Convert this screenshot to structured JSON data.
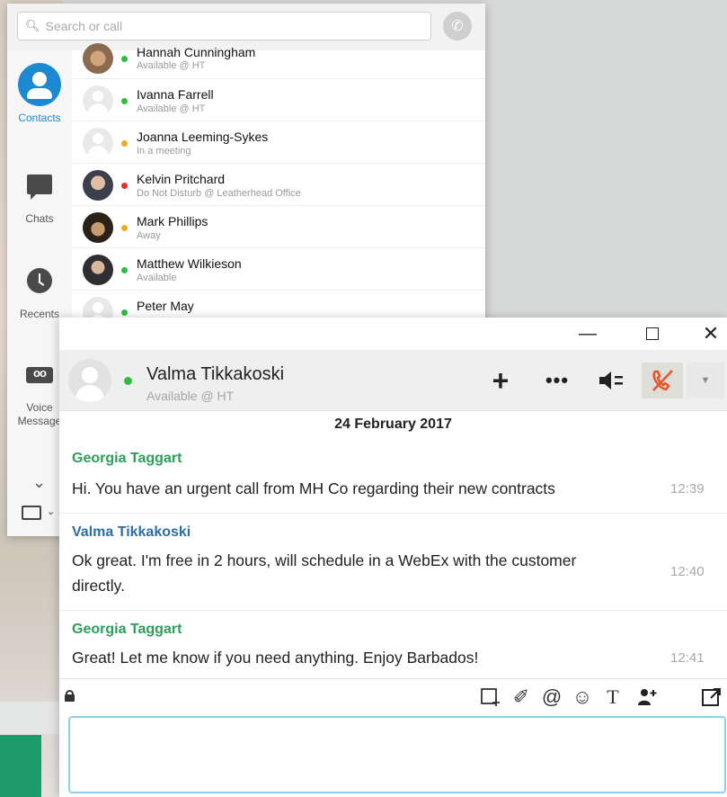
{
  "contacts_window": {
    "search": {
      "placeholder": "Search or call"
    },
    "nav": [
      {
        "label": "Contacts",
        "icon": "contacts-icon",
        "active": true
      },
      {
        "label": "Chats",
        "icon": "chat-icon"
      },
      {
        "label": "Recents",
        "icon": "clock-icon"
      },
      {
        "label": "Voice Message",
        "icon": "voicemail-icon"
      }
    ],
    "contacts": [
      {
        "name": "Hannah Cunningham",
        "status": "Available @ HT",
        "presence_color": "#2ebd3e"
      },
      {
        "name": "Ivanna Farrell",
        "status": "Available @ HT",
        "presence_color": "#2ebd3e"
      },
      {
        "name": "Joanna Leeming-Sykes",
        "status": "In a meeting",
        "presence_color": "#f5a623"
      },
      {
        "name": "Kelvin Pritchard",
        "status": "Do Not Disturb @ Leatherhead Office",
        "presence_color": "#e0312b"
      },
      {
        "name": "Mark Phillips",
        "status": "Away",
        "presence_color": "#f5a623"
      },
      {
        "name": "Matthew Wilkieson",
        "status": "Available",
        "presence_color": "#2ebd3e"
      },
      {
        "name": "Peter May",
        "status": "",
        "presence_color": "#2ebd3e"
      }
    ]
  },
  "chat_window": {
    "titlebar": {
      "minimize": "—",
      "close": "✕"
    },
    "header": {
      "name": "Valma Tikkakoski",
      "status": "Available @ HT",
      "presence_color": "#2ebd3e",
      "add": "+",
      "more": "•••"
    },
    "date": "24 February 2017",
    "messages": [
      {
        "sender": "Georgia Taggart",
        "sender_color": "#2e9e5b",
        "text": "Hi. You have an urgent call from MH Co regarding their new contracts",
        "time": "12:39"
      },
      {
        "sender": "Valma Tikkakoski",
        "sender_color": "#2d6ea6",
        "text": "Ok great. I'm free in 2 hours, will schedule in a WebEx with the customer directly.",
        "time": "12:40"
      },
      {
        "sender": "Georgia Taggart",
        "sender_color": "#2e9e5b",
        "text": "Great! Let me know if you need anything. Enjoy Barbados!",
        "time": "12:41"
      }
    ],
    "tools": [
      "screenshot-icon",
      "attach-icon",
      "mention-icon",
      "emoji-icon",
      "font-icon",
      "add-participant-icon",
      "popout-icon"
    ],
    "compose_value": ""
  }
}
